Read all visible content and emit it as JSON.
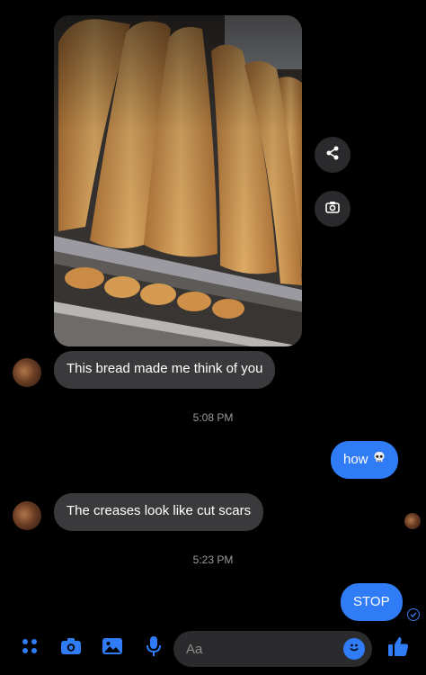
{
  "conversation": {
    "photo": {
      "icon": "bread-photo",
      "description_icon": "image"
    },
    "photo_actions": {
      "share_icon": "share-icon",
      "camera_icon": "camera-icon"
    },
    "messages": [
      {
        "sender": "contact",
        "text": "This bread made me think of you"
      },
      {
        "sender": "me",
        "text": "how",
        "emoji_icon": "skull-icon"
      },
      {
        "sender": "contact",
        "text": "The creases look like cut scars"
      },
      {
        "sender": "me",
        "text": "STOP"
      }
    ],
    "timestamps": [
      "5:08 PM",
      "5:23 PM"
    ]
  },
  "composer": {
    "placeholder": "Aa",
    "tools": [
      "apps-icon",
      "camera-icon",
      "gallery-icon",
      "mic-icon"
    ],
    "emoji_icon": "smiley-icon",
    "like_icon": "thumbs-up-icon"
  },
  "colors": {
    "background": "#000000",
    "incoming_bubble": "#3a3a3c",
    "outgoing_bubble": "#2f7cf6",
    "accent": "#2f7cf6"
  }
}
